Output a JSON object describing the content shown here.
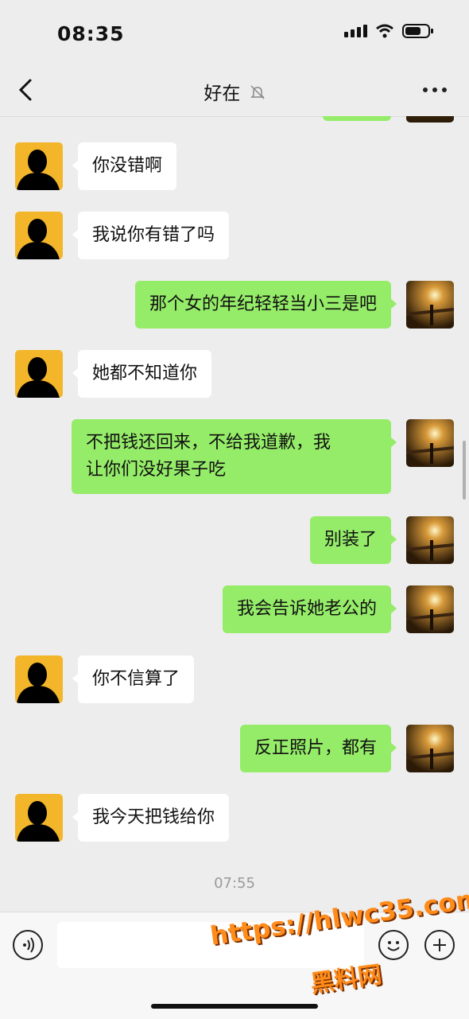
{
  "status_bar": {
    "time": "08:35"
  },
  "header": {
    "title": "好在",
    "icons": [
      "back-icon",
      "mute-bell-icon",
      "more-icon"
    ]
  },
  "messages": [
    {
      "side": "left",
      "text": "你没错啊"
    },
    {
      "side": "left",
      "text": "我说你有错了吗"
    },
    {
      "side": "right",
      "text": "那个女的年纪轻轻当小三是吧"
    },
    {
      "side": "left",
      "text": "她都不知道你"
    },
    {
      "side": "right",
      "text": "不把钱还回来，不给我道歉，我\n让你们没好果子吃"
    },
    {
      "side": "right",
      "text": "别装了"
    },
    {
      "side": "right",
      "text": "我会告诉她老公的"
    },
    {
      "side": "left",
      "text": "你不信算了"
    },
    {
      "side": "right",
      "text": "反正照片，都有"
    },
    {
      "side": "left",
      "text": "我今天把钱给你"
    }
  ],
  "timestamp": "07:55",
  "input_bar": {
    "icons": [
      "voice-icon",
      "emoji-icon",
      "plus-icon"
    ]
  },
  "watermark": {
    "line1": "https://hlwc35.com",
    "line2": "黑料网"
  }
}
